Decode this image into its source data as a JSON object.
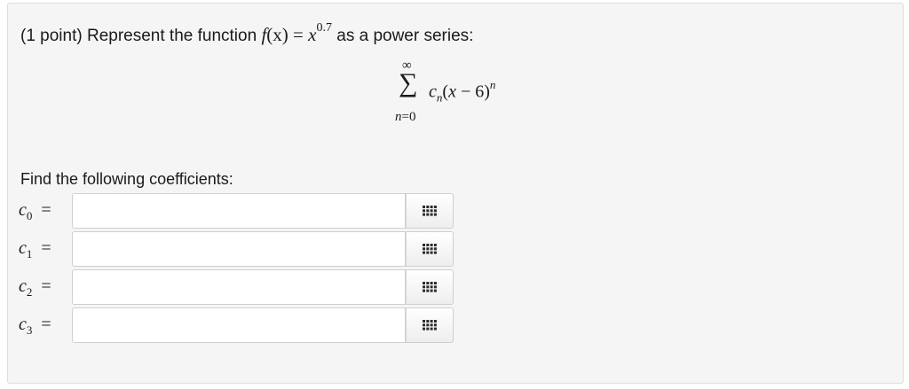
{
  "question": {
    "prefix": "(1 point) Represent the function",
    "func_name": "f",
    "func_var": "(x)",
    "equals": " = ",
    "base": "x",
    "exponent": "0.7",
    "suffix": "as a power series:"
  },
  "series": {
    "upper": "∞",
    "sigma": "∑",
    "lower_var": "n",
    "lower_rest": "=0",
    "coef": "c",
    "coef_sub": "n",
    "open": "(",
    "x": "x",
    "minus_center": " − 6)",
    "power": "n"
  },
  "find_label": "Find the following coefficients:",
  "coefficients": [
    {
      "symbol": "c",
      "index": "0",
      "equals": "=",
      "value": ""
    },
    {
      "symbol": "c",
      "index": "1",
      "equals": "=",
      "value": ""
    },
    {
      "symbol": "c",
      "index": "2",
      "equals": "=",
      "value": ""
    },
    {
      "symbol": "c",
      "index": "3",
      "equals": "=",
      "value": ""
    }
  ],
  "palette_icon": "grid-palette-icon",
  "colors": {
    "panel_bg": "#f5f5f5",
    "panel_border": "#dedede",
    "input_border": "#cfcfcf",
    "icon": "#2b2b2b"
  }
}
